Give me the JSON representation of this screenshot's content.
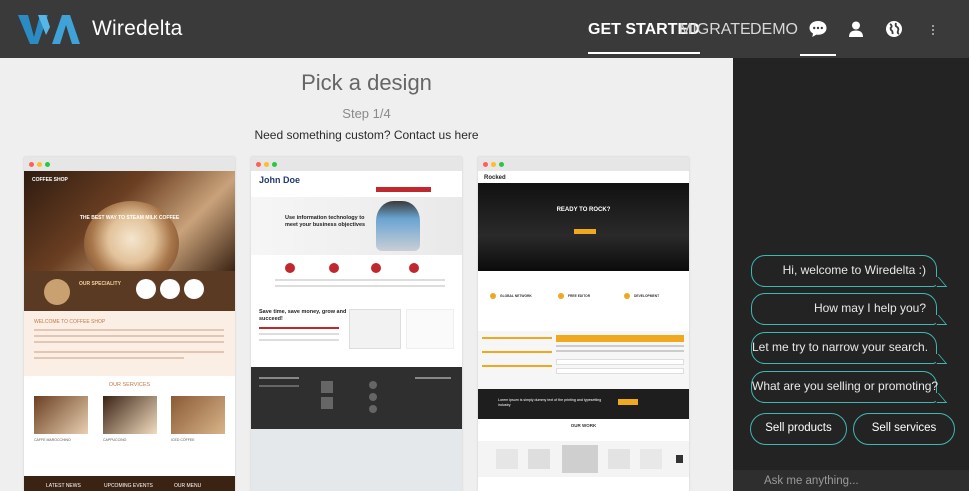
{
  "app": {
    "name": "Wiredelta"
  },
  "nav": {
    "items": [
      {
        "label": "GET STARTED",
        "active": true
      },
      {
        "label": "MIGRATE",
        "active": false
      },
      {
        "label": "DEMO",
        "active": false
      }
    ],
    "icons": [
      "chat-icon",
      "user-icon",
      "globe-icon",
      "more-vertical-icon"
    ]
  },
  "main": {
    "title": "Pick a design",
    "step": "Step 1/4",
    "contact": "Need something custom? Contact us here"
  },
  "designs": [
    {
      "name": "coffee-shop",
      "brand": "COFFEE SHOP",
      "hero": "THE BEST WAY TO STEAM MILK COFFEE",
      "speciality": "OUR SPECIALITY",
      "welcome": "WELCOME TO COFFEE SHOP",
      "services_heading": "OUR SERVICES",
      "services": [
        "CAFFE MAROCCHINO",
        "CAPPUCCINO",
        "ICED COFFEE"
      ],
      "footer": [
        "LATEST NEWS",
        "UPCOMING EVENTS",
        "OUR MENU"
      ]
    },
    {
      "name": "john-doe",
      "brand": "John Doe",
      "hero": "Use information technology to meet your business objectives",
      "tagline": "Save time, save money, grow and succeed!"
    },
    {
      "name": "rocked",
      "brand": "Rocked",
      "hero": "READY TO ROCK?",
      "features": [
        "GLOBAL NETWORK",
        "FREE EDITOR",
        "DEVELOPMENT"
      ],
      "cta": "Lorem ipsum is simply dummy text of the printing and typesetting industry",
      "work_heading": "OUR WORK"
    }
  ],
  "chat": {
    "messages": [
      "Hi, welcome to Wiredelta :)",
      "How may I help you?",
      "Let me try to narrow your search.",
      "What are you selling or promoting?"
    ],
    "options": [
      "Sell products",
      "Sell services"
    ],
    "input_placeholder": "Ask me anything..."
  },
  "colors": {
    "topbar": "#3a3a3a",
    "chat_bg": "#232323",
    "chat_accent": "#3fb8b4",
    "logo_blue": "#3fa3d8"
  }
}
